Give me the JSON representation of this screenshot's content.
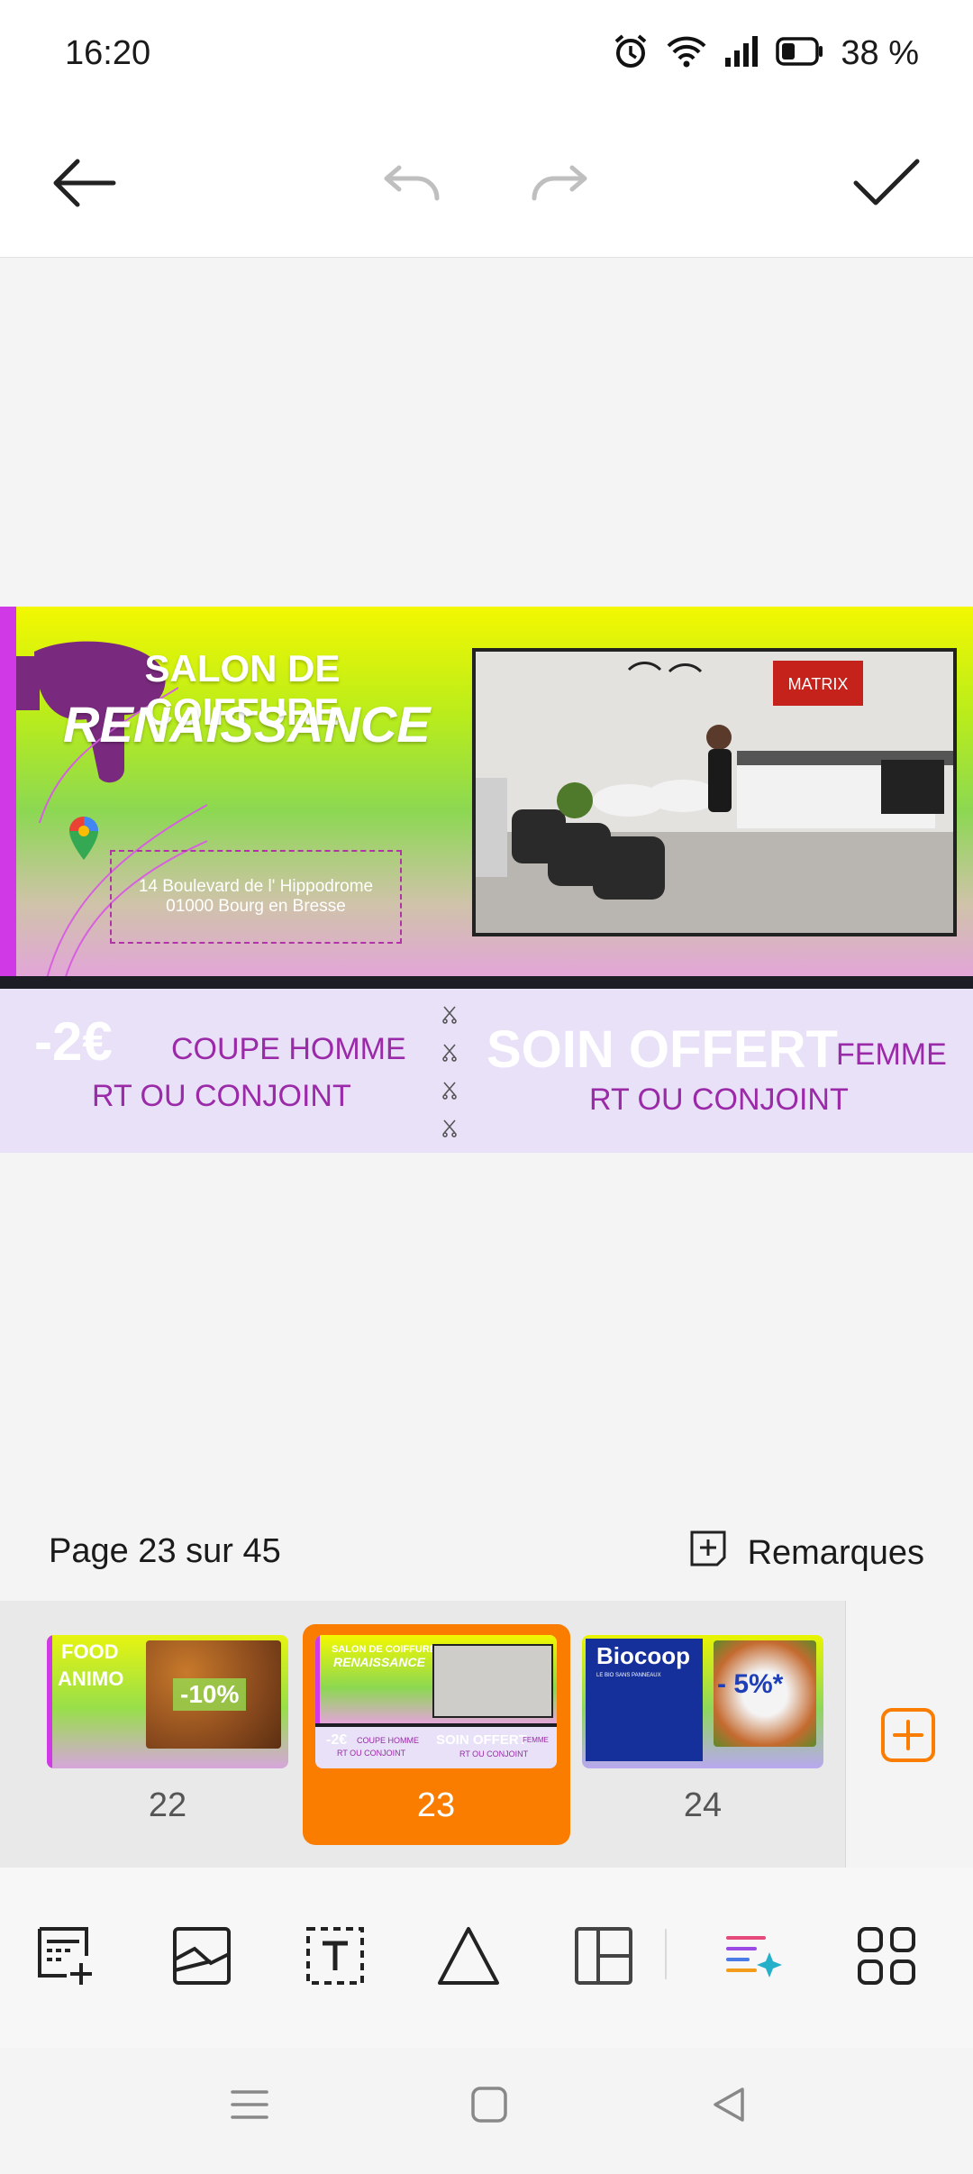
{
  "status_bar": {
    "time": "16:20",
    "battery_percent": "38 %",
    "icons": [
      "alarm-icon",
      "wifi-icon",
      "signal-icon",
      "battery-icon"
    ]
  },
  "toolbar": {
    "back_icon": "arrow-left-icon",
    "undo_icon": "undo-icon",
    "redo_icon": "redo-icon",
    "confirm_icon": "checkmark-icon"
  },
  "slide": {
    "title_line1": "SALON DE COIFFURE",
    "title_line2": "RENAISSANCE",
    "address_line1": "14 Boulevard de l'   Hippodrome",
    "address_line2": "01000 Bourg en Bresse",
    "photo_sign": "MATRIX",
    "coupon_left_price": "-2€",
    "coupon_left_service": "COUPE HOMME",
    "coupon_left_target": "RT OU CONJOINT",
    "coupon_right_offer": "SOIN OFFERT",
    "coupon_right_service": "FEMME",
    "coupon_right_target": "RT OU CONJOINT",
    "colors": {
      "title": "#ffffff",
      "coupon_text": "#9b2aa8",
      "accent_bar": "#cf39e6"
    }
  },
  "page_info": {
    "label": "Page 23 sur 45",
    "remarks_label": "Remarques"
  },
  "thumbnails": [
    {
      "number": "22",
      "title_line1": "FOOD",
      "title_line2": "ANIMO",
      "discount": "-10%",
      "selected": false
    },
    {
      "number": "23",
      "title_line1": "SALON DE COIFFURE",
      "title_line2": "RENAISSANCE",
      "coupon_left": "-2€",
      "coupon_left_service": "COUPE HOMME",
      "coupon_left_target": "RT OU CONJOINT",
      "coupon_right": "SOIN OFFERT",
      "coupon_right_service": "FEMME",
      "coupon_right_target": "RT OU CONJOINT",
      "selected": true
    },
    {
      "number": "24",
      "title_line1": "Biocoop",
      "title_line2": "LE BIO SANS PANNEAUX",
      "discount": "- 5%*",
      "selected": false
    }
  ],
  "accent_color": "#fb7d00",
  "bottom_tools": [
    "new-slide-icon",
    "image-icon",
    "text-box-icon",
    "shape-icon",
    "layout-icon",
    "ai-assistant-icon",
    "more-apps-icon"
  ],
  "nav_bar": [
    "menu-icon",
    "home-icon",
    "back-icon"
  ]
}
